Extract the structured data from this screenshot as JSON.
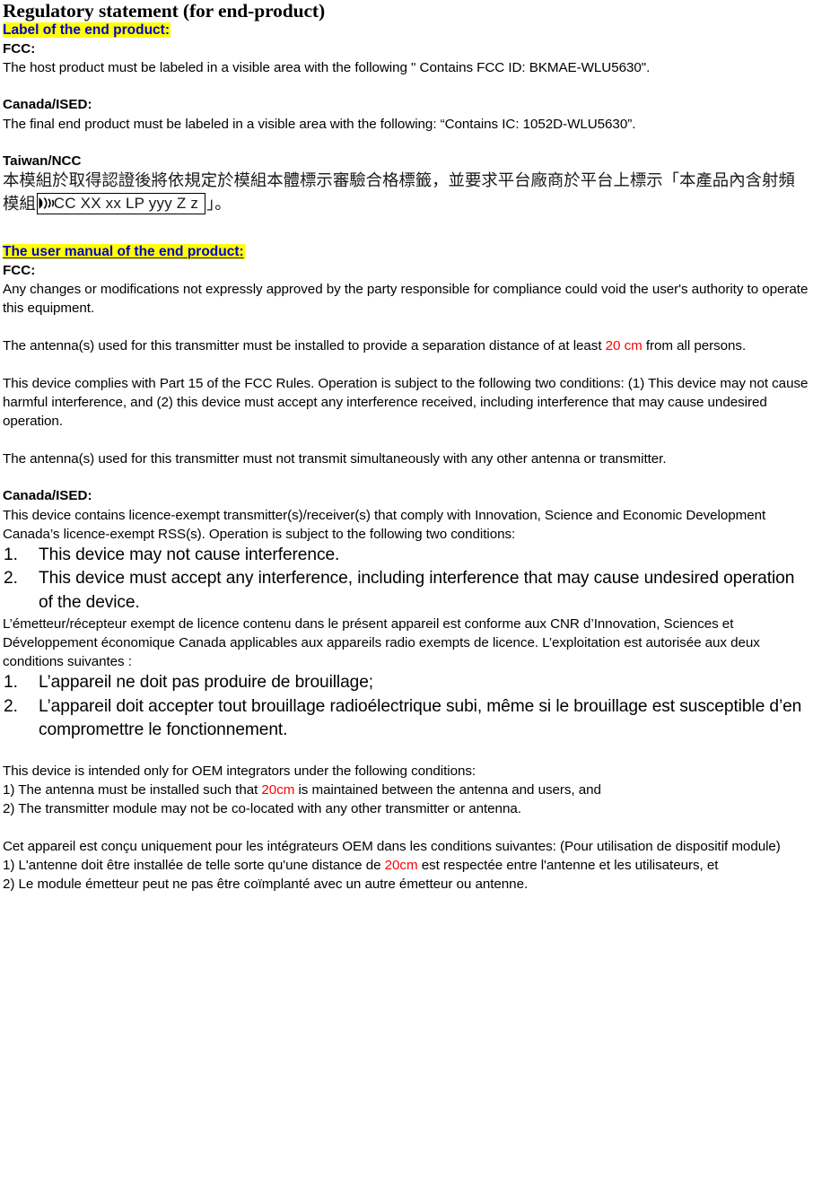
{
  "document": {
    "title": "Regulatory statement (for end-product)"
  },
  "section_label": {
    "heading": "Label of the end product:",
    "fcc": {
      "label": "FCC:",
      "paragraph": "The host product must be labeled in a visible area with the following \" Contains FCC ID: BKMAE-WLU5630\"."
    },
    "canada": {
      "label": "Canada/ISED:",
      "paragraph": "The final end product must be labeled in a visible area with the following: “Contains IC: 1052D-WLU5630”."
    },
    "taiwan": {
      "label": "Taiwan/NCC",
      "paragraph_part1": "本模組於取得認證後將依規定於模組本體標示審驗合格標籤，並要求平台廠商於平台上標示「本產品內含射頻模組",
      "ncc_box_icon": "ncc-radio-waves-icon",
      "ncc_box_text": "CC XX xx LP yyy Z z",
      "paragraph_part2": "」。"
    }
  },
  "section_manual": {
    "heading": "The user manual of the end product:",
    "fcc": {
      "label": "FCC:",
      "paragraph1": "Any changes or modifications not expressly approved by the party responsible for compliance could void the user's authority to operate this equipment.",
      "paragraph2_a": "The antenna(s) used for this transmitter must be installed to provide a separation distance of at least ",
      "paragraph2_highlight": "20 cm",
      "paragraph2_b": " from all persons.",
      "paragraph3": "This device complies with Part 15 of the FCC Rules. Operation is subject to the following two conditions: (1) This device may not cause harmful interference, and (2) this device must accept any interference received, including interference that may cause undesired operation.",
      "paragraph4": "The antenna(s) used for this transmitter must not transmit simultaneously with any other antenna or transmitter."
    },
    "canada": {
      "label": "Canada/ISED:",
      "intro_en": "This device contains licence-exempt transmitter(s)/receiver(s) that comply with Innovation, Science and Economic Development Canada’s licence-exempt RSS(s). Operation is subject to the following two conditions:",
      "list_en": [
        {
          "num": "1.",
          "text": "This device may not cause interference."
        },
        {
          "num": "2.",
          "text": "This device must accept any interference, including interference that may cause undesired operation of the device."
        }
      ],
      "intro_fr": "L’émetteur/récepteur exempt de licence contenu dans le présent appareil est conforme aux CNR d’Innovation, Sciences et Développement économique Canada applicables aux appareils radio exempts de licence. L’exploitation est autorisée aux deux conditions suivantes :",
      "list_fr": [
        {
          "num": "1.",
          "text": "L’appareil ne doit pas produire de brouillage;"
        },
        {
          "num": "2.",
          "text": "L’appareil doit accepter tout brouillage radioélectrique subi, même si le brouillage est susceptible d’en compromettre le fonctionnement."
        }
      ]
    },
    "oem_en": {
      "intro": "This device is intended only for OEM integrators under the following conditions:",
      "item1_a": "1) The antenna must be installed such that ",
      "item1_highlight": "20cm",
      "item1_b": " is maintained between the antenna and users, and",
      "item2": "2) The transmitter module may not be co-located with any other transmitter or antenna."
    },
    "oem_fr": {
      "intro": "Cet appareil est conçu uniquement pour les intégrateurs OEM dans les conditions suivantes: (Pour utilisation de dispositif module)",
      "item1_a": "1) L'antenne doit être installée de telle sorte qu'une distance de ",
      "item1_highlight": "20cm",
      "item1_b": " est respectée entre l'antenne et les utilisateurs, et",
      "item2": "2) Le module émetteur peut ne pas être coïmplanté avec un autre émetteur ou antenne."
    }
  },
  "colors": {
    "heading_text": "#0000CC",
    "highlight": "#FFFF00",
    "emphasis_red": "#FF0000",
    "body_text": "#000000"
  }
}
